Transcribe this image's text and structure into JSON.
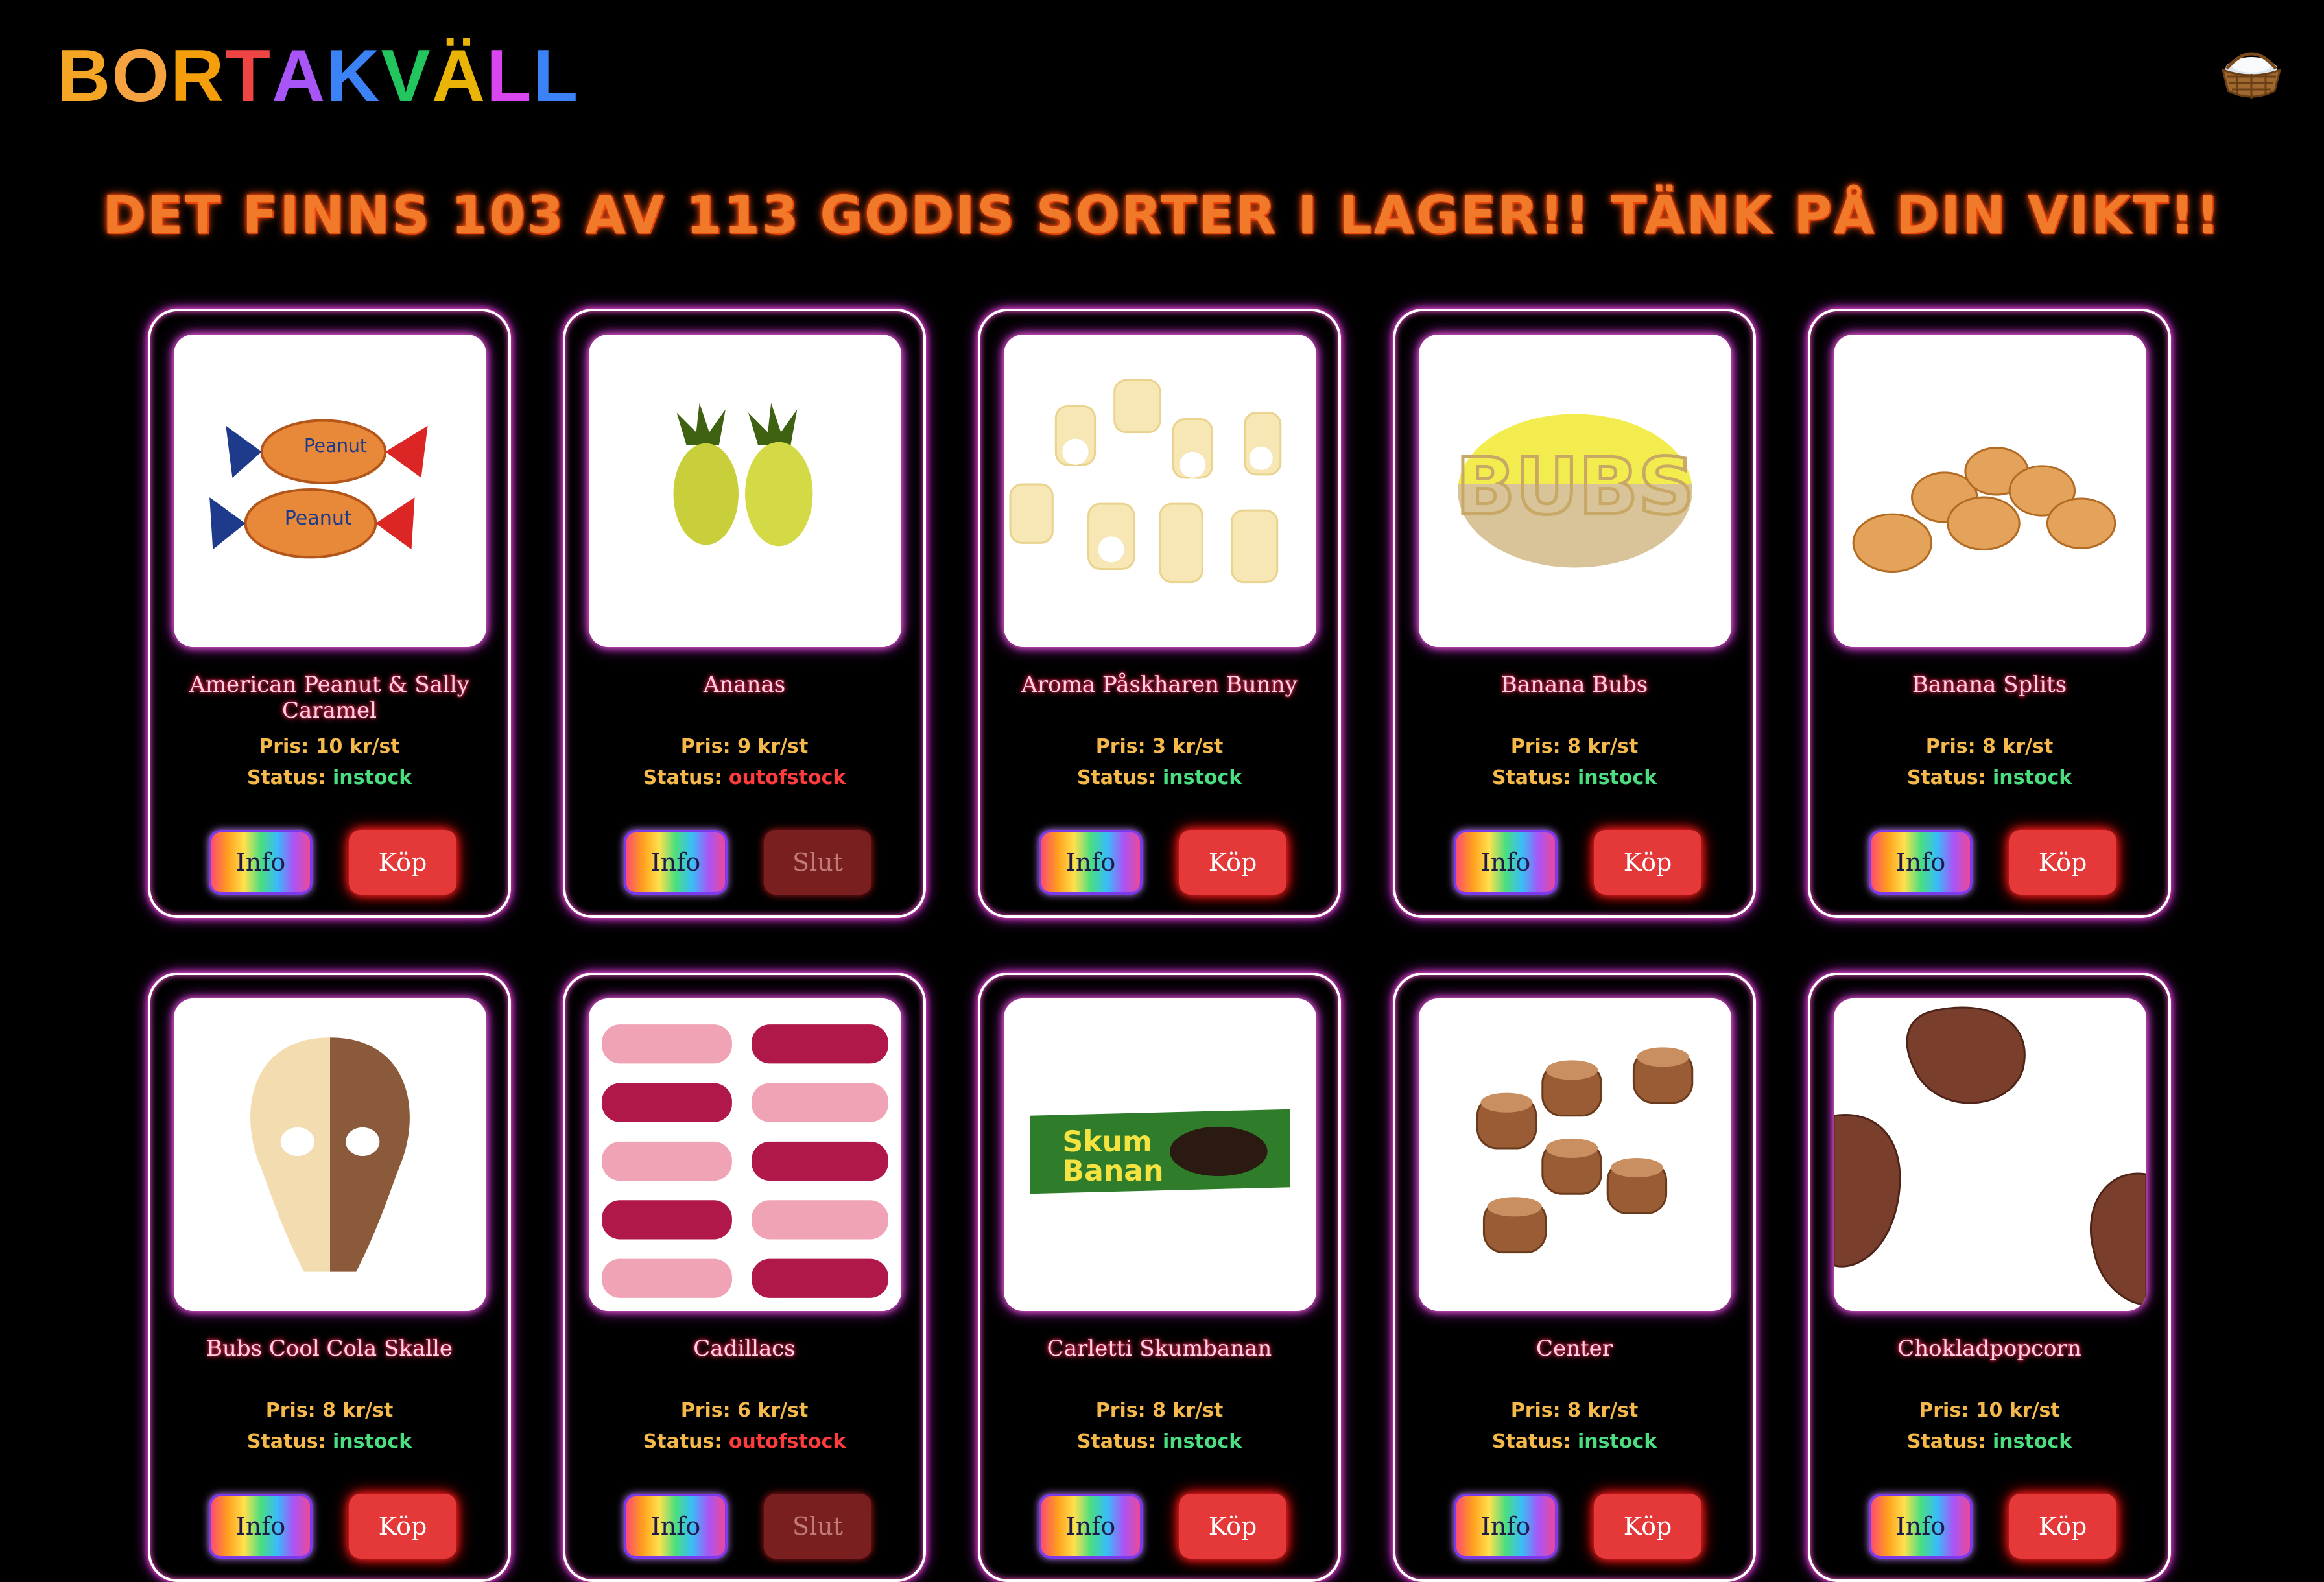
{
  "header": {
    "logo_letters": [
      {
        "ch": "B",
        "color": "#f5a524"
      },
      {
        "ch": "O",
        "color": "#f4a340"
      },
      {
        "ch": "R",
        "color": "#f59e0b"
      },
      {
        "ch": "T",
        "color": "#ef4444"
      },
      {
        "ch": "A",
        "color": "#a855f7"
      },
      {
        "ch": "K",
        "color": "#3b82f6"
      },
      {
        "ch": "V",
        "color": "#22c55e"
      },
      {
        "ch": "Ä",
        "color": "#eab308"
      },
      {
        "ch": "L",
        "color": "#d946ef"
      },
      {
        "ch": "L",
        "color": "#3b82f6"
      }
    ],
    "cart_icon": "basket-icon"
  },
  "headline": "DET FINNS 103 AV 113 GODIS SORTER I LAGER!! TÄNK PÅ DIN VIKT!!",
  "labels": {
    "price_prefix": "Pris:",
    "status_prefix": "Status:",
    "info_button": "Info",
    "buy_button": "Köp",
    "sold_out_button": "Slut"
  },
  "products": [
    {
      "name": "American Peanut & Sally Caramel",
      "price": "10 kr/st",
      "status": "instock",
      "image": "caramel-candy"
    },
    {
      "name": "Ananas",
      "price": "9 kr/st",
      "status": "outofstock",
      "image": "pineapple-candy"
    },
    {
      "name": "Aroma Påskharen Bunny",
      "price": "3 kr/st",
      "status": "instock",
      "image": "bunny-candy"
    },
    {
      "name": "Banana Bubs",
      "price": "8 kr/st",
      "status": "instock",
      "image": "bubs-candy"
    },
    {
      "name": "Banana Splits",
      "price": "8 kr/st",
      "status": "instock",
      "image": "splits-candy"
    },
    {
      "name": "Bubs Cool Cola Skalle",
      "price": "8 kr/st",
      "status": "instock",
      "image": "skull-candy"
    },
    {
      "name": "Cadillacs",
      "price": "6 kr/st",
      "status": "outofstock",
      "image": "cadillac-candy"
    },
    {
      "name": "Carletti Skumbanan",
      "price": "8 kr/st",
      "status": "instock",
      "image": "skumbanan-bar"
    },
    {
      "name": "Center",
      "price": "8 kr/st",
      "status": "instock",
      "image": "center-chocolate"
    },
    {
      "name": "Chokladpopcorn",
      "price": "10 kr/st",
      "status": "instock",
      "image": "chocolate-popcorn"
    }
  ]
}
